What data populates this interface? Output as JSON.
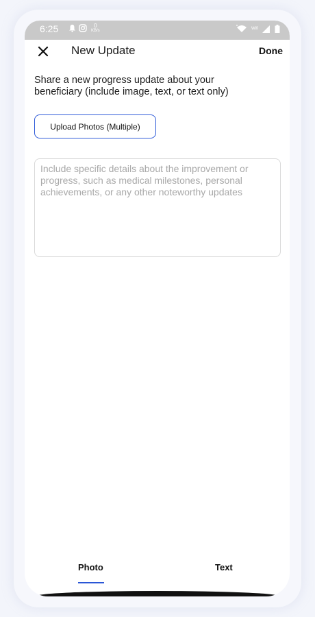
{
  "status_bar": {
    "time": "6:25",
    "speed_value": "0",
    "speed_unit": "KB/s",
    "wifi_label": "Wifi"
  },
  "header": {
    "title": "New Update",
    "done_label": "Done"
  },
  "intro_text": "Share a new progress update about your beneficiary (include image, text, or text only)",
  "upload_button_label": "Upload Photos (Multiple)",
  "details_field": {
    "value": "",
    "placeholder": "Include specific details about the improvement or progress, such as medical milestones, personal achievements, or any other noteworthy updates"
  },
  "tabs": [
    {
      "label": "Photo",
      "active": true
    },
    {
      "label": "Text",
      "active": false
    }
  ],
  "colors": {
    "accent": "#2a56d6",
    "statusbar_bg": "#c9c9c9",
    "text": "#1b1b1b",
    "placeholder": "#a8a8a8"
  },
  "icons": {
    "close": "close-icon",
    "notification": "bell-icon",
    "instagram": "instagram-icon",
    "wifi": "wifi-icon",
    "signal": "signal-icon",
    "battery": "battery-icon"
  }
}
